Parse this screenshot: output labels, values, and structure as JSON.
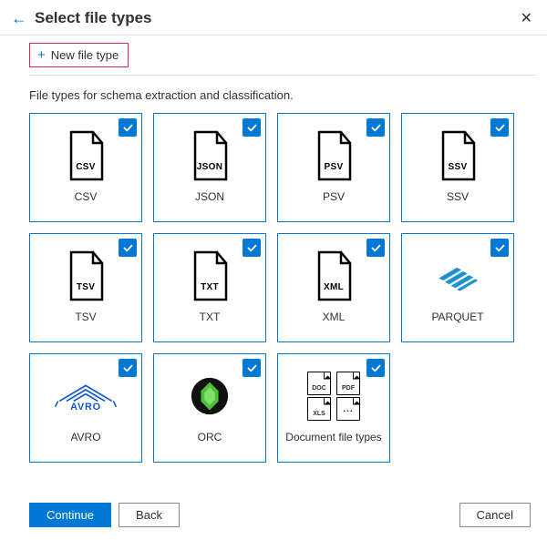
{
  "header": {
    "title": "Select file types"
  },
  "toolbar": {
    "new_file_type_label": "New file type"
  },
  "subtitle": "File types for schema extraction and classification.",
  "tiles": [
    {
      "label": "CSV",
      "icon_text": "CSV",
      "icon": "file",
      "checked": true
    },
    {
      "label": "JSON",
      "icon_text": "JSON",
      "icon": "file",
      "checked": true
    },
    {
      "label": "PSV",
      "icon_text": "PSV",
      "icon": "file",
      "checked": true
    },
    {
      "label": "SSV",
      "icon_text": "SSV",
      "icon": "file",
      "checked": true
    },
    {
      "label": "TSV",
      "icon_text": "TSV",
      "icon": "file",
      "checked": true
    },
    {
      "label": "TXT",
      "icon_text": "TXT",
      "icon": "file",
      "checked": true
    },
    {
      "label": "XML",
      "icon_text": "XML",
      "icon": "file",
      "checked": true
    },
    {
      "label": "PARQUET",
      "icon_text": "",
      "icon": "parquet",
      "checked": true
    },
    {
      "label": "AVRO",
      "icon_text": "",
      "icon": "avro",
      "checked": true
    },
    {
      "label": "ORC",
      "icon_text": "",
      "icon": "orc",
      "checked": true
    },
    {
      "label": "Document file types",
      "icon_text": "",
      "icon": "docs",
      "checked": true
    }
  ],
  "docs_mini_labels": [
    "DOC",
    "PDF",
    "XLS",
    "..."
  ],
  "footer": {
    "continue_label": "Continue",
    "back_label": "Back",
    "cancel_label": "Cancel"
  },
  "colors": {
    "primary": "#0078d4",
    "highlight_border": "#d62b4b"
  }
}
